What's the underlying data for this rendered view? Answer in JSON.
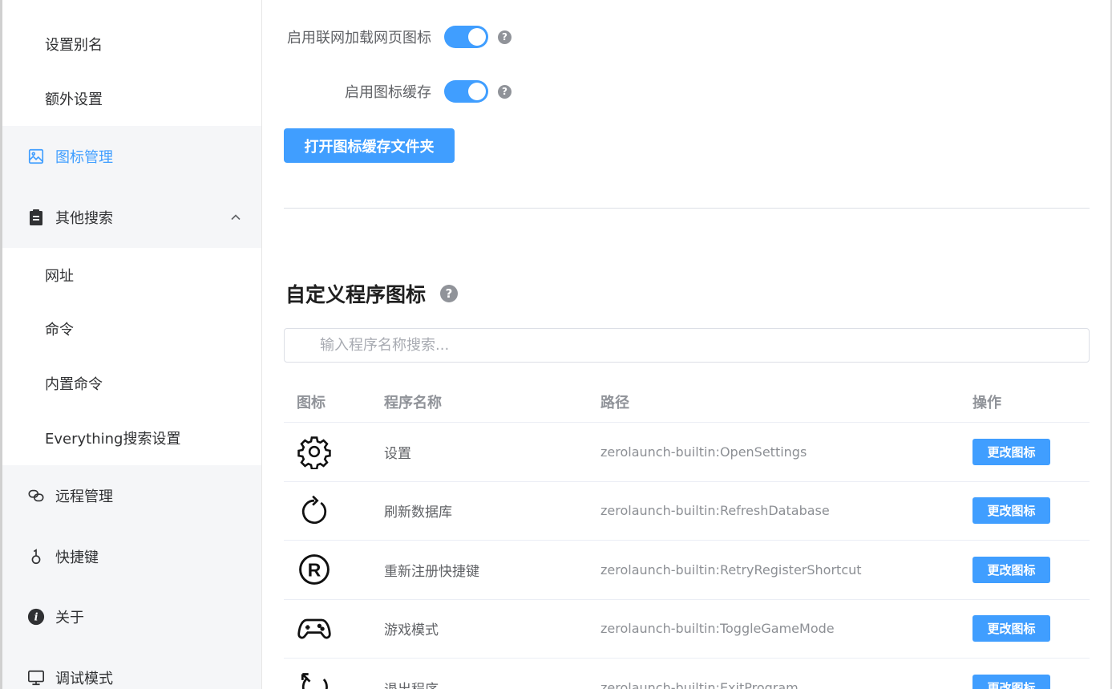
{
  "sidebar": {
    "items": [
      {
        "label": "设置别名",
        "icon": "",
        "level": "sub"
      },
      {
        "label": "额外设置",
        "icon": "",
        "level": "sub"
      },
      {
        "label": "图标管理",
        "icon": "image-icon",
        "level": "top",
        "active": true
      },
      {
        "label": "其他搜索",
        "icon": "clipboard-icon",
        "level": "top",
        "expanded": true
      },
      {
        "label": "网址",
        "icon": "",
        "level": "sub"
      },
      {
        "label": "命令",
        "icon": "",
        "level": "sub"
      },
      {
        "label": "内置命令",
        "icon": "",
        "level": "sub"
      },
      {
        "label": "Everything搜索设置",
        "icon": "",
        "level": "sub"
      },
      {
        "label": "远程管理",
        "icon": "link-icon",
        "level": "top"
      },
      {
        "label": "快捷键",
        "icon": "key-icon",
        "level": "top"
      },
      {
        "label": "关于",
        "icon": "info-icon",
        "level": "top"
      },
      {
        "label": "调试模式",
        "icon": "monitor-icon",
        "level": "top"
      }
    ]
  },
  "settings": {
    "online_icon_label": "启用联网加载网页图标",
    "online_icon_enabled": true,
    "icon_cache_label": "启用图标缓存",
    "icon_cache_enabled": true,
    "open_cache_button": "打开图标缓存文件夹"
  },
  "custom": {
    "title": "自定义程序图标",
    "search_placeholder": "输入程序名称搜索...",
    "columns": {
      "icon": "图标",
      "name": "程序名称",
      "path": "路径",
      "action": "操作"
    },
    "rows": [
      {
        "icon": "gear-icon",
        "name": "设置",
        "path": "zerolaunch-builtin:OpenSettings",
        "action": "更改图标"
      },
      {
        "icon": "refresh-icon",
        "name": "刷新数据库",
        "path": "zerolaunch-builtin:RefreshDatabase",
        "action": "更改图标"
      },
      {
        "icon": "registered-icon",
        "name": "重新注册快捷键",
        "path": "zerolaunch-builtin:RetryRegisterShortcut",
        "action": "更改图标"
      },
      {
        "icon": "gamepad-icon",
        "name": "游戏模式",
        "path": "zerolaunch-builtin:ToggleGameMode",
        "action": "更改图标"
      },
      {
        "icon": "exit-icon",
        "name": "退出程序",
        "path": "zerolaunch-builtin:ExitProgram",
        "action": "更改图标"
      }
    ]
  },
  "colors": {
    "accent": "#409eff",
    "sidebar_group_bg": "#f5f6f8"
  }
}
